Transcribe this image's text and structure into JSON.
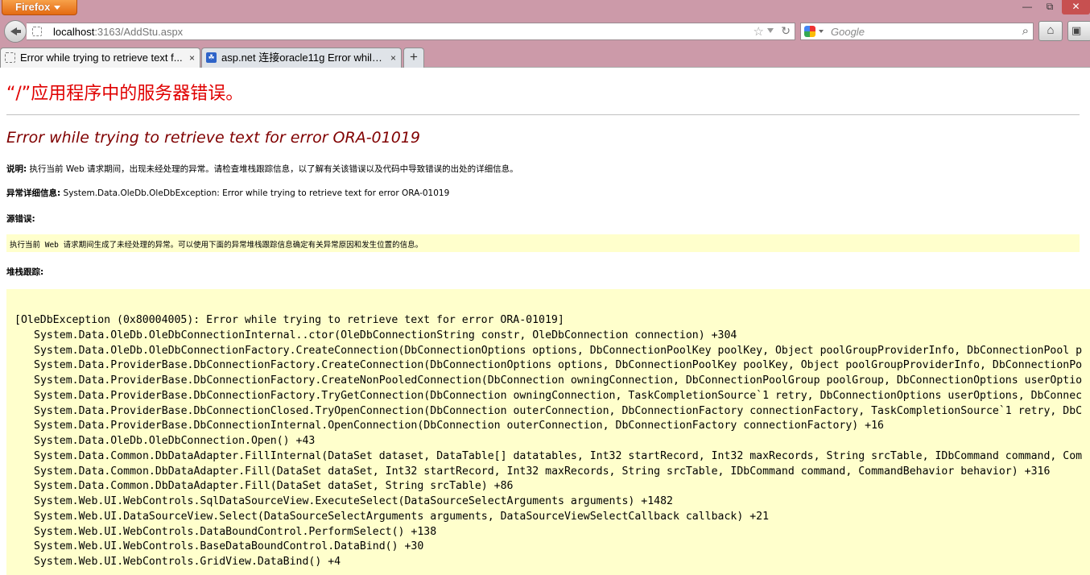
{
  "browser": {
    "menu_label": "Firefox",
    "url_host": "localhost",
    "url_rest": ":3163/AddStu.aspx",
    "search_placeholder": "Google",
    "tabs": [
      {
        "label": "Error while trying to retrieve text f...",
        "close": "×"
      },
      {
        "label": "asp.net 连接oracle11g Error while ...",
        "close": "×"
      }
    ],
    "new_tab": "+"
  },
  "page": {
    "server_heading": "“/”应用程序中的服务器错误。",
    "error_title": "Error while trying to retrieve text for error ORA-01019",
    "description_label": "说明:",
    "description_text": " 执行当前 Web 请求期间，出现未经处理的异常。请检查堆栈跟踪信息，以了解有关该错误以及代码中导致错误的出处的详细信息。",
    "exception_label": "异常详细信息:",
    "exception_text": " System.Data.OleDb.OleDbException: Error while trying to retrieve text for error ORA-01019",
    "source_label": "源错误:",
    "source_text": "执行当前 Web 请求期间生成了未经处理的异常。可以使用下面的异常堆栈跟踪信息确定有关异常原因和发生位置的信息。",
    "stack_label": "堆栈跟踪:",
    "stack_lines": [
      "[OleDbException (0x80004005): Error while trying to retrieve text for error ORA-01019]",
      "System.Data.OleDb.OleDbConnectionInternal..ctor(OleDbConnectionString constr, OleDbConnection connection) +304",
      "System.Data.OleDb.OleDbConnectionFactory.CreateConnection(DbConnectionOptions options, DbConnectionPoolKey poolKey, Object poolGroupProviderInfo, DbConnectionPool p",
      "System.Data.ProviderBase.DbConnectionFactory.CreateConnection(DbConnectionOptions options, DbConnectionPoolKey poolKey, Object poolGroupProviderInfo, DbConnectionPo",
      "System.Data.ProviderBase.DbConnectionFactory.CreateNonPooledConnection(DbConnection owningConnection, DbConnectionPoolGroup poolGroup, DbConnectionOptions userOptio",
      "System.Data.ProviderBase.DbConnectionFactory.TryGetConnection(DbConnection owningConnection, TaskCompletionSource`1 retry, DbConnectionOptions userOptions, DbConnec",
      "System.Data.ProviderBase.DbConnectionClosed.TryOpenConnection(DbConnection outerConnection, DbConnectionFactory connectionFactory, TaskCompletionSource`1 retry, DbC",
      "System.Data.ProviderBase.DbConnectionInternal.OpenConnection(DbConnection outerConnection, DbConnectionFactory connectionFactory) +16",
      "System.Data.OleDb.OleDbConnection.Open() +43",
      "System.Data.Common.DbDataAdapter.FillInternal(DataSet dataset, DataTable[] datatables, Int32 startRecord, Int32 maxRecords, String srcTable, IDbCommand command, Com",
      "System.Data.Common.DbDataAdapter.Fill(DataSet dataSet, Int32 startRecord, Int32 maxRecords, String srcTable, IDbCommand command, CommandBehavior behavior) +316",
      "System.Data.Common.DbDataAdapter.Fill(DataSet dataSet, String srcTable) +86",
      "System.Web.UI.WebControls.SqlDataSourceView.ExecuteSelect(DataSourceSelectArguments arguments) +1482",
      "System.Web.UI.DataSourceView.Select(DataSourceSelectArguments arguments, DataSourceViewSelectCallback callback) +21",
      "System.Web.UI.WebControls.DataBoundControl.PerformSelect() +138",
      "System.Web.UI.WebControls.BaseDataBoundControl.DataBind() +30",
      "System.Web.UI.WebControls.GridView.DataBind() +4"
    ]
  },
  "icons": {
    "back": "back-arrow-icon",
    "site": "blank-page-icon",
    "star": "bookmark-star-icon",
    "reload": "reload-icon",
    "engine": "google-icon",
    "search": "magnifier-icon",
    "home": "home-icon"
  },
  "colors": {
    "chrome": "#cc9aa9",
    "heading_red": "#e00000",
    "error_maroon": "#800000",
    "code_background": "#ffffcc"
  }
}
